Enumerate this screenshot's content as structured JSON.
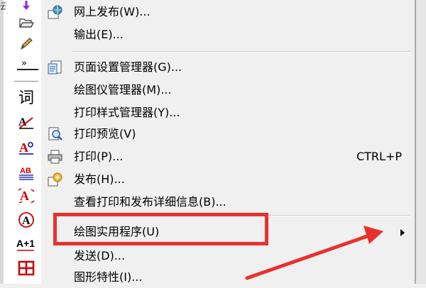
{
  "toolbar": {
    "top_label": "云",
    "icons": [
      "arrow-down-purple-icon",
      "open-folder-icon",
      "pencil-edit-icon",
      "chevron-double-right-icon",
      "word-text-icon",
      "check-text-icon",
      "text-style-icon",
      "underline-text-icon",
      "text-edit-icon",
      "text-circle-icon",
      "text-plus-one-icon",
      "red-table-icon"
    ],
    "chevron": "»",
    "word_glyph": "词",
    "superscript": "A+1"
  },
  "menu": {
    "items": [
      {
        "label": "网上发布(W)...",
        "icon": "globe-publish-icon"
      },
      {
        "label": "输出(E)...",
        "icon": ""
      },
      {
        "label": "页面设置管理器(G)...",
        "icon": "page-setup-icon"
      },
      {
        "label": "绘图仪管理器(M)...",
        "icon": ""
      },
      {
        "label": "打印样式管理器(Y)...",
        "icon": ""
      },
      {
        "label": "打印预览(V)",
        "icon": "print-preview-icon"
      },
      {
        "label": "打印(P)...",
        "icon": "printer-icon",
        "shortcut": "CTRL+P"
      },
      {
        "label": "发布(H)...",
        "icon": "publish-icon"
      },
      {
        "label": "查看打印和发布详细信息(B)...",
        "icon": ""
      },
      {
        "label": "绘图实用程序(U)",
        "icon": "",
        "submenu": true
      },
      {
        "label": "发送(D)...",
        "icon": ""
      },
      {
        "label": "图形特性(I)...",
        "icon": ""
      }
    ]
  },
  "colors": {
    "highlight": "#e8312f",
    "menu_bg": "#f0f0f0"
  }
}
